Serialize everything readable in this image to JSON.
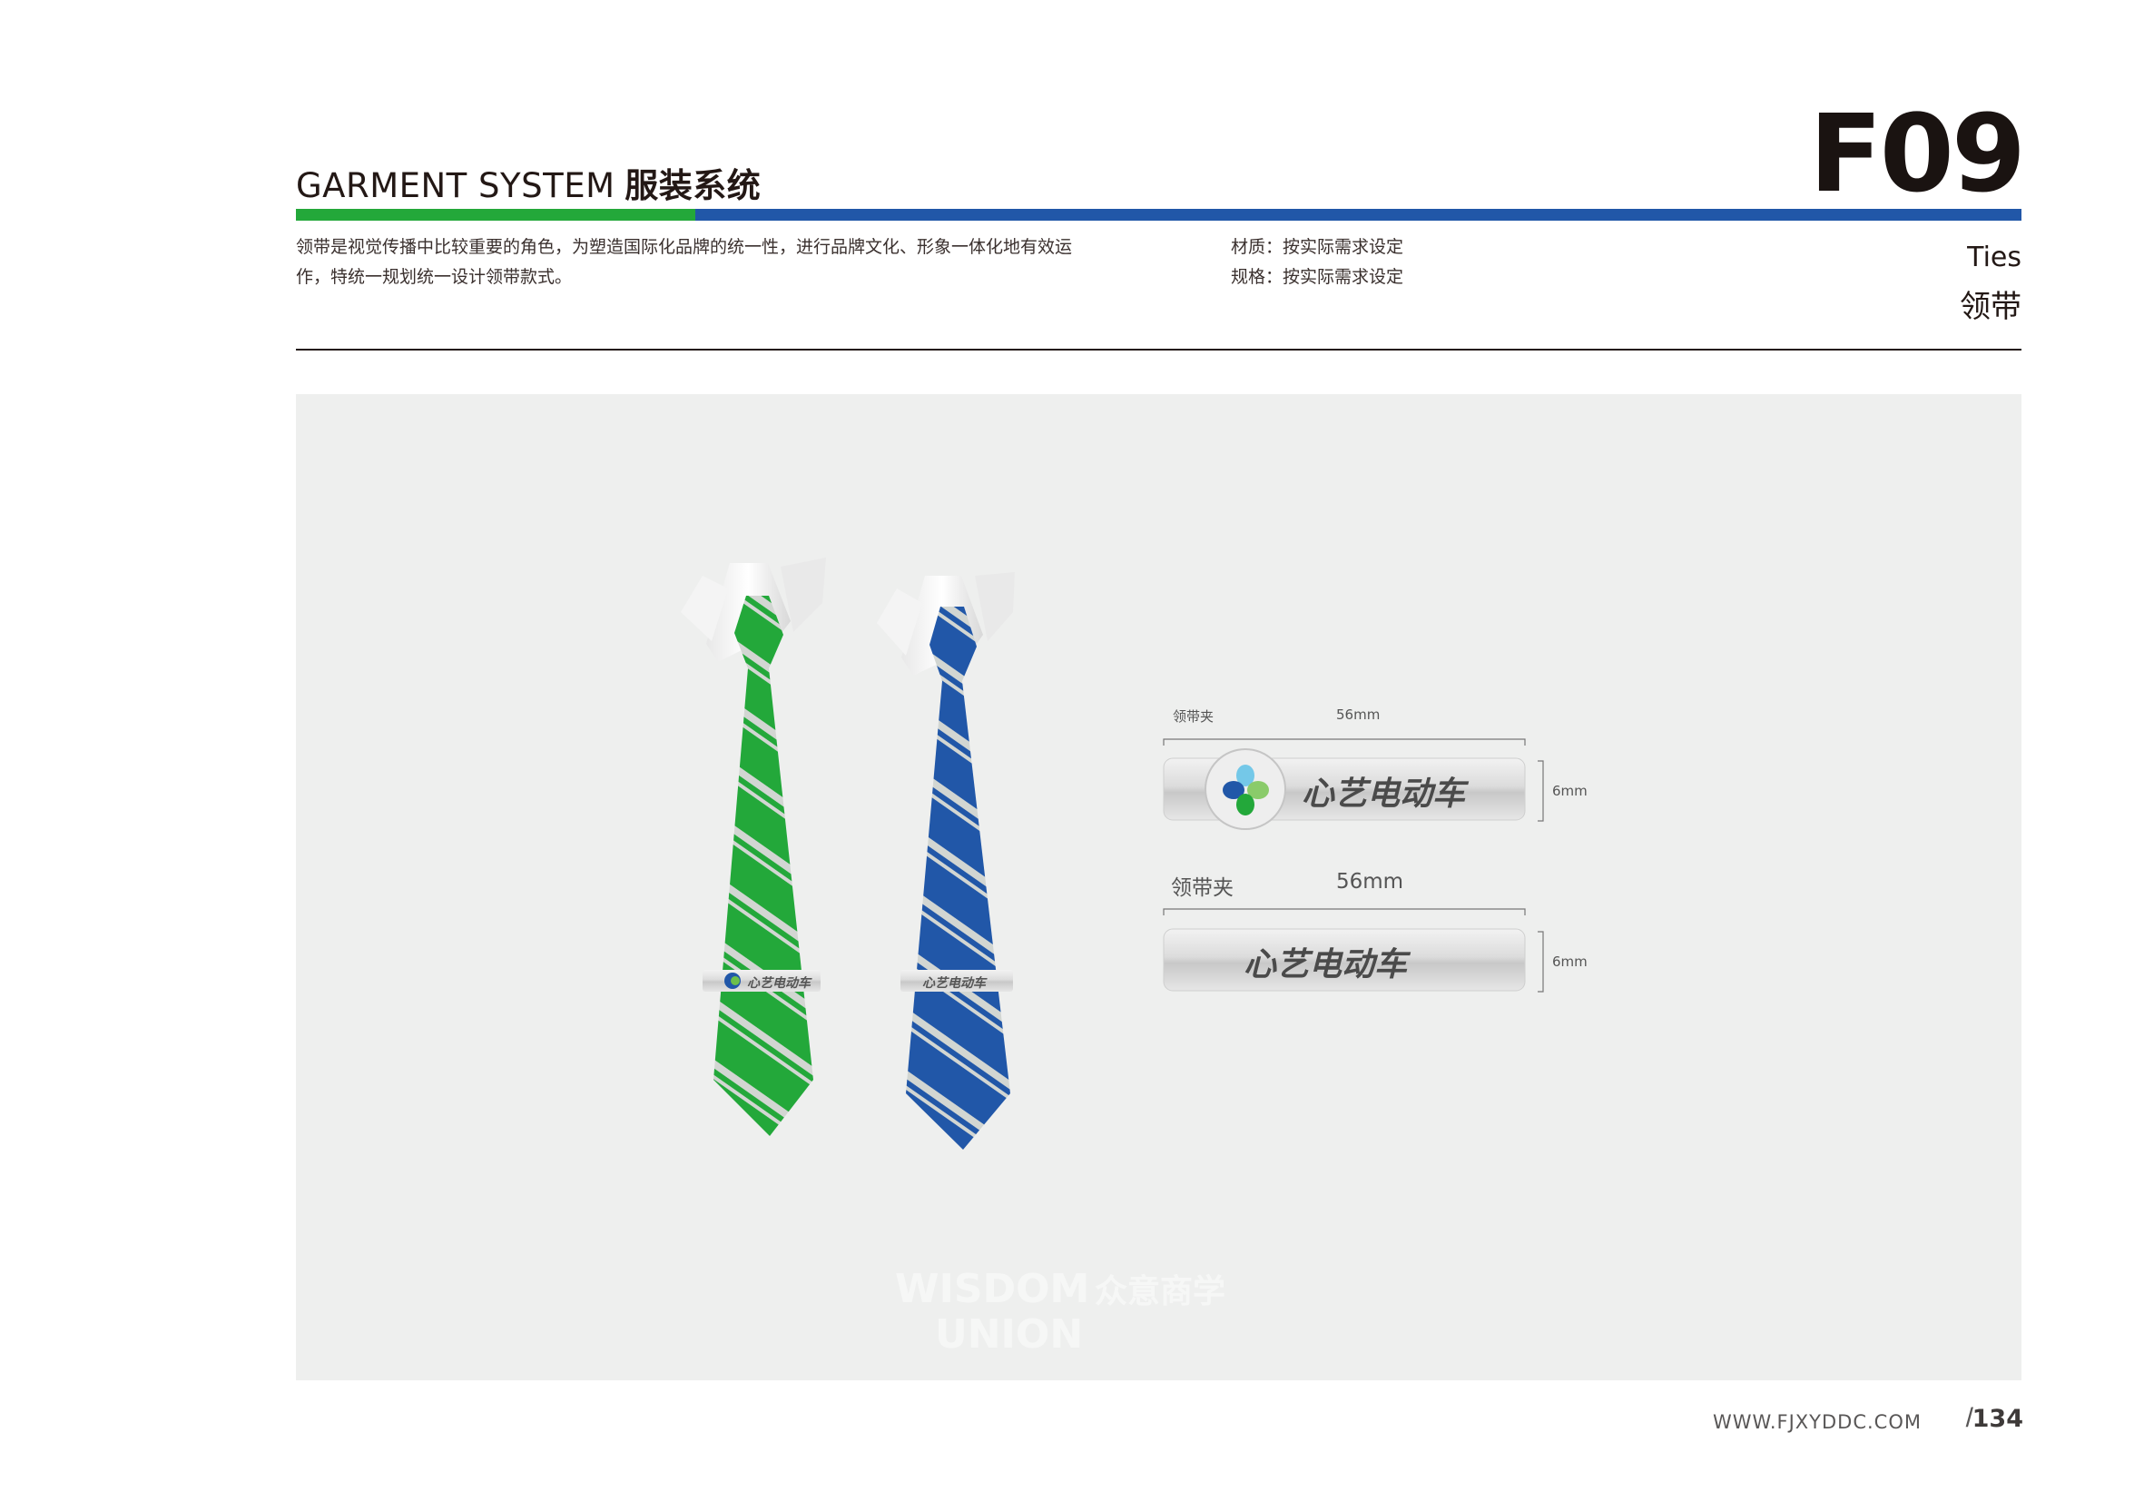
{
  "header": {
    "title_en": "GARMENT SYSTEM",
    "title_cn": "服装系统",
    "page_code": "F09"
  },
  "colors": {
    "brand_green": "#23a83a",
    "brand_blue": "#2157a8",
    "text_dark": "#231815",
    "canvas_bg": "#eeefee"
  },
  "description": {
    "line1": "领带是视觉传播中比较重要的角色，为塑造国际化品牌的统一性，进行品牌文化、形象一体化地有效运",
    "line2": "作，特统一规划统一设计领带款式。"
  },
  "specs": {
    "material": "材质：按实际需求设定",
    "size": "规格：按实际需求设定"
  },
  "section": {
    "en": "Ties",
    "cn": "领带"
  },
  "clips": [
    {
      "label": "领带夹",
      "width": "56mm",
      "height": "6mm",
      "brand_text": "心艺电动车",
      "has_logo": true
    },
    {
      "label": "领带夹",
      "width": "56mm",
      "height": "6mm",
      "brand_text": "心艺电动车",
      "has_logo": false
    }
  ],
  "ties": [
    {
      "color": "green",
      "clip_text": "心艺电动车"
    },
    {
      "color": "blue",
      "clip_text": "心艺电动车"
    }
  ],
  "watermark": {
    "line1": "WISDOM",
    "line2": "UNION",
    "cn": "众意商学"
  },
  "footer": {
    "url": "WWW.FJXYDDC.COM",
    "page": "134"
  }
}
